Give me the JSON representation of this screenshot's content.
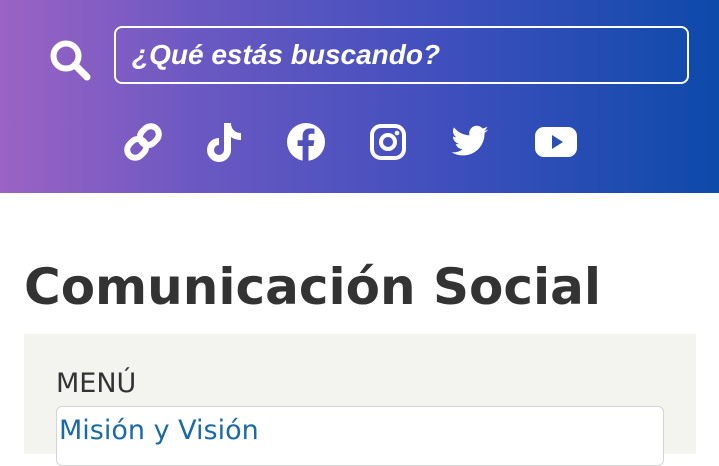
{
  "header": {
    "colors": {
      "gradient_start": "#9b63c4",
      "gradient_end": "#0d4aaa",
      "foreground": "#ffffff"
    },
    "search": {
      "icon": "search-icon",
      "placeholder": "¿Qué estás buscando?"
    },
    "social_links": [
      {
        "name": "link",
        "icon": "link-icon"
      },
      {
        "name": "tiktok",
        "icon": "tiktok-icon"
      },
      {
        "name": "facebook",
        "icon": "facebook-icon"
      },
      {
        "name": "instagram",
        "icon": "instagram-icon"
      },
      {
        "name": "twitter",
        "icon": "twitter-icon"
      },
      {
        "name": "youtube",
        "icon": "youtube-icon"
      }
    ]
  },
  "main": {
    "page_title": "Comunicación Social",
    "menu": {
      "heading": "MENÚ",
      "items": [
        {
          "label": "Misión y Visión"
        }
      ],
      "link_color": "#1a6aa8"
    }
  }
}
